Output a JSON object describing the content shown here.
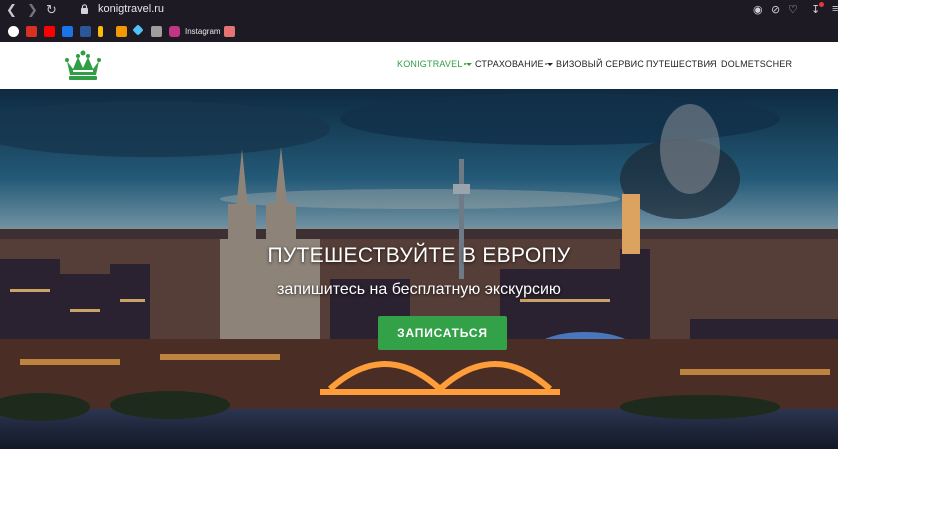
{
  "browser": {
    "url": "konigtravel.ru",
    "back_icon": "chevron-left-icon",
    "forward_icon": "chevron-right-icon",
    "reload_icon": "reload-icon",
    "bookmarks": [
      {
        "icon": "google-icon",
        "color": "#ea4335"
      },
      {
        "icon": "gmail-icon",
        "color": "#d93025"
      },
      {
        "icon": "youtube-icon",
        "color": "#ff0000"
      },
      {
        "icon": "message-icon",
        "color": "#1a73e8"
      },
      {
        "icon": "word-icon",
        "color": "#2b579a"
      },
      {
        "icon": "pen-icon",
        "color": "#fbbc04"
      },
      {
        "icon": "orange-square-icon",
        "color": "#f29900"
      },
      {
        "icon": "diamond-icon",
        "color": "#4fc3f7"
      },
      {
        "icon": "person-icon",
        "color": "#9e9e9e"
      },
      {
        "icon": "instagram-icon",
        "color": "#c13584",
        "label": "Instagram"
      },
      {
        "icon": "photo-icon",
        "color": "#e57373"
      }
    ]
  },
  "header": {
    "logo_icon": "crown-logo-icon",
    "brand_color": "#2f9e44",
    "nav": [
      {
        "label": "KONIGTRAVEL",
        "active": true,
        "dropdown": true
      },
      {
        "label": "СТРАХОВАНИЕ",
        "active": false,
        "dropdown": true
      },
      {
        "label": "ВИЗОВЫЙ СЕРВИС",
        "active": false,
        "dropdown": false
      },
      {
        "label": "ПУТЕШЕСТВИЯ",
        "active": false,
        "dropdown": false
      },
      {
        "label": "DOLMETSCHER",
        "active": false,
        "dropdown": false
      }
    ]
  },
  "hero": {
    "title": "ПУТЕШЕСТВУЙТЕ В ЕВРОПУ",
    "subtitle": "запишитесь на бесплатную экскурсию",
    "button": "ЗАПИСАТЬСЯ",
    "button_color": "#33a148"
  }
}
